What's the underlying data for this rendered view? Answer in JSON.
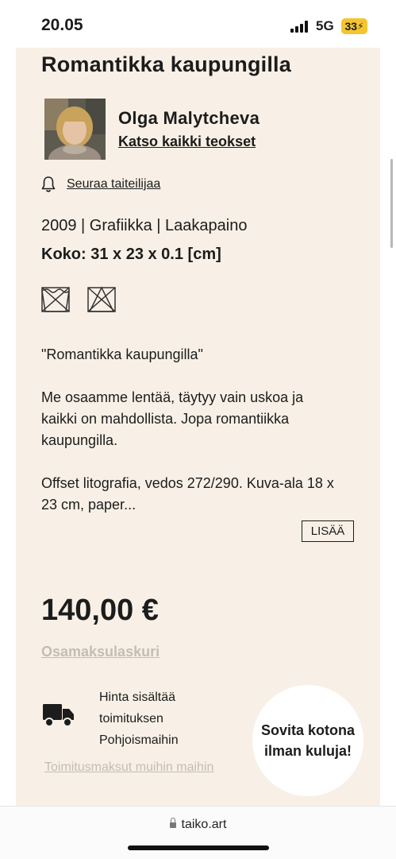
{
  "status": {
    "time": "20.05",
    "network": "5G",
    "battery": "33"
  },
  "artwork": {
    "title": "Romantikka kaupungilla",
    "artist_name": "Olga Malytcheva",
    "all_works_link": "Katso kaikki teokset",
    "follow_label": "Seuraa taiteilijaa",
    "meta": "2009 | Grafiikka | Laakapaino",
    "size": "Koko: 31 x 23 x 0.1 [cm]",
    "description": [
      "\"Romantikka kaupungilla\"",
      "Me osaamme lentää, täytyy vain uskoa ja kaikki on mahdollista. Jopa romantiikka kaupungilla.",
      "Offset litografia, vedos 272/290. Kuva-ala 18 x 23 cm, paper..."
    ],
    "more_button": "LISÄÄ"
  },
  "pricing": {
    "price": "140,00 €",
    "installment_link": "Osamaksulaskuri",
    "shipping_info": "Hinta sisältää toimituksen Pohjoismaihin",
    "shipping_link": "Toimitusmaksut muihin maihin",
    "bubble_text": "Sovita kotona ilman kuluja!"
  },
  "browser": {
    "url": "taiko.art"
  },
  "icons": [
    "bell-icon",
    "no-washing-icon",
    "no-ironing-icon",
    "truck-icon",
    "lock-icon"
  ],
  "colors": {
    "card_background": "#f8f0e6",
    "muted_link": "#c3bdb5",
    "battery": "#f4c530"
  }
}
